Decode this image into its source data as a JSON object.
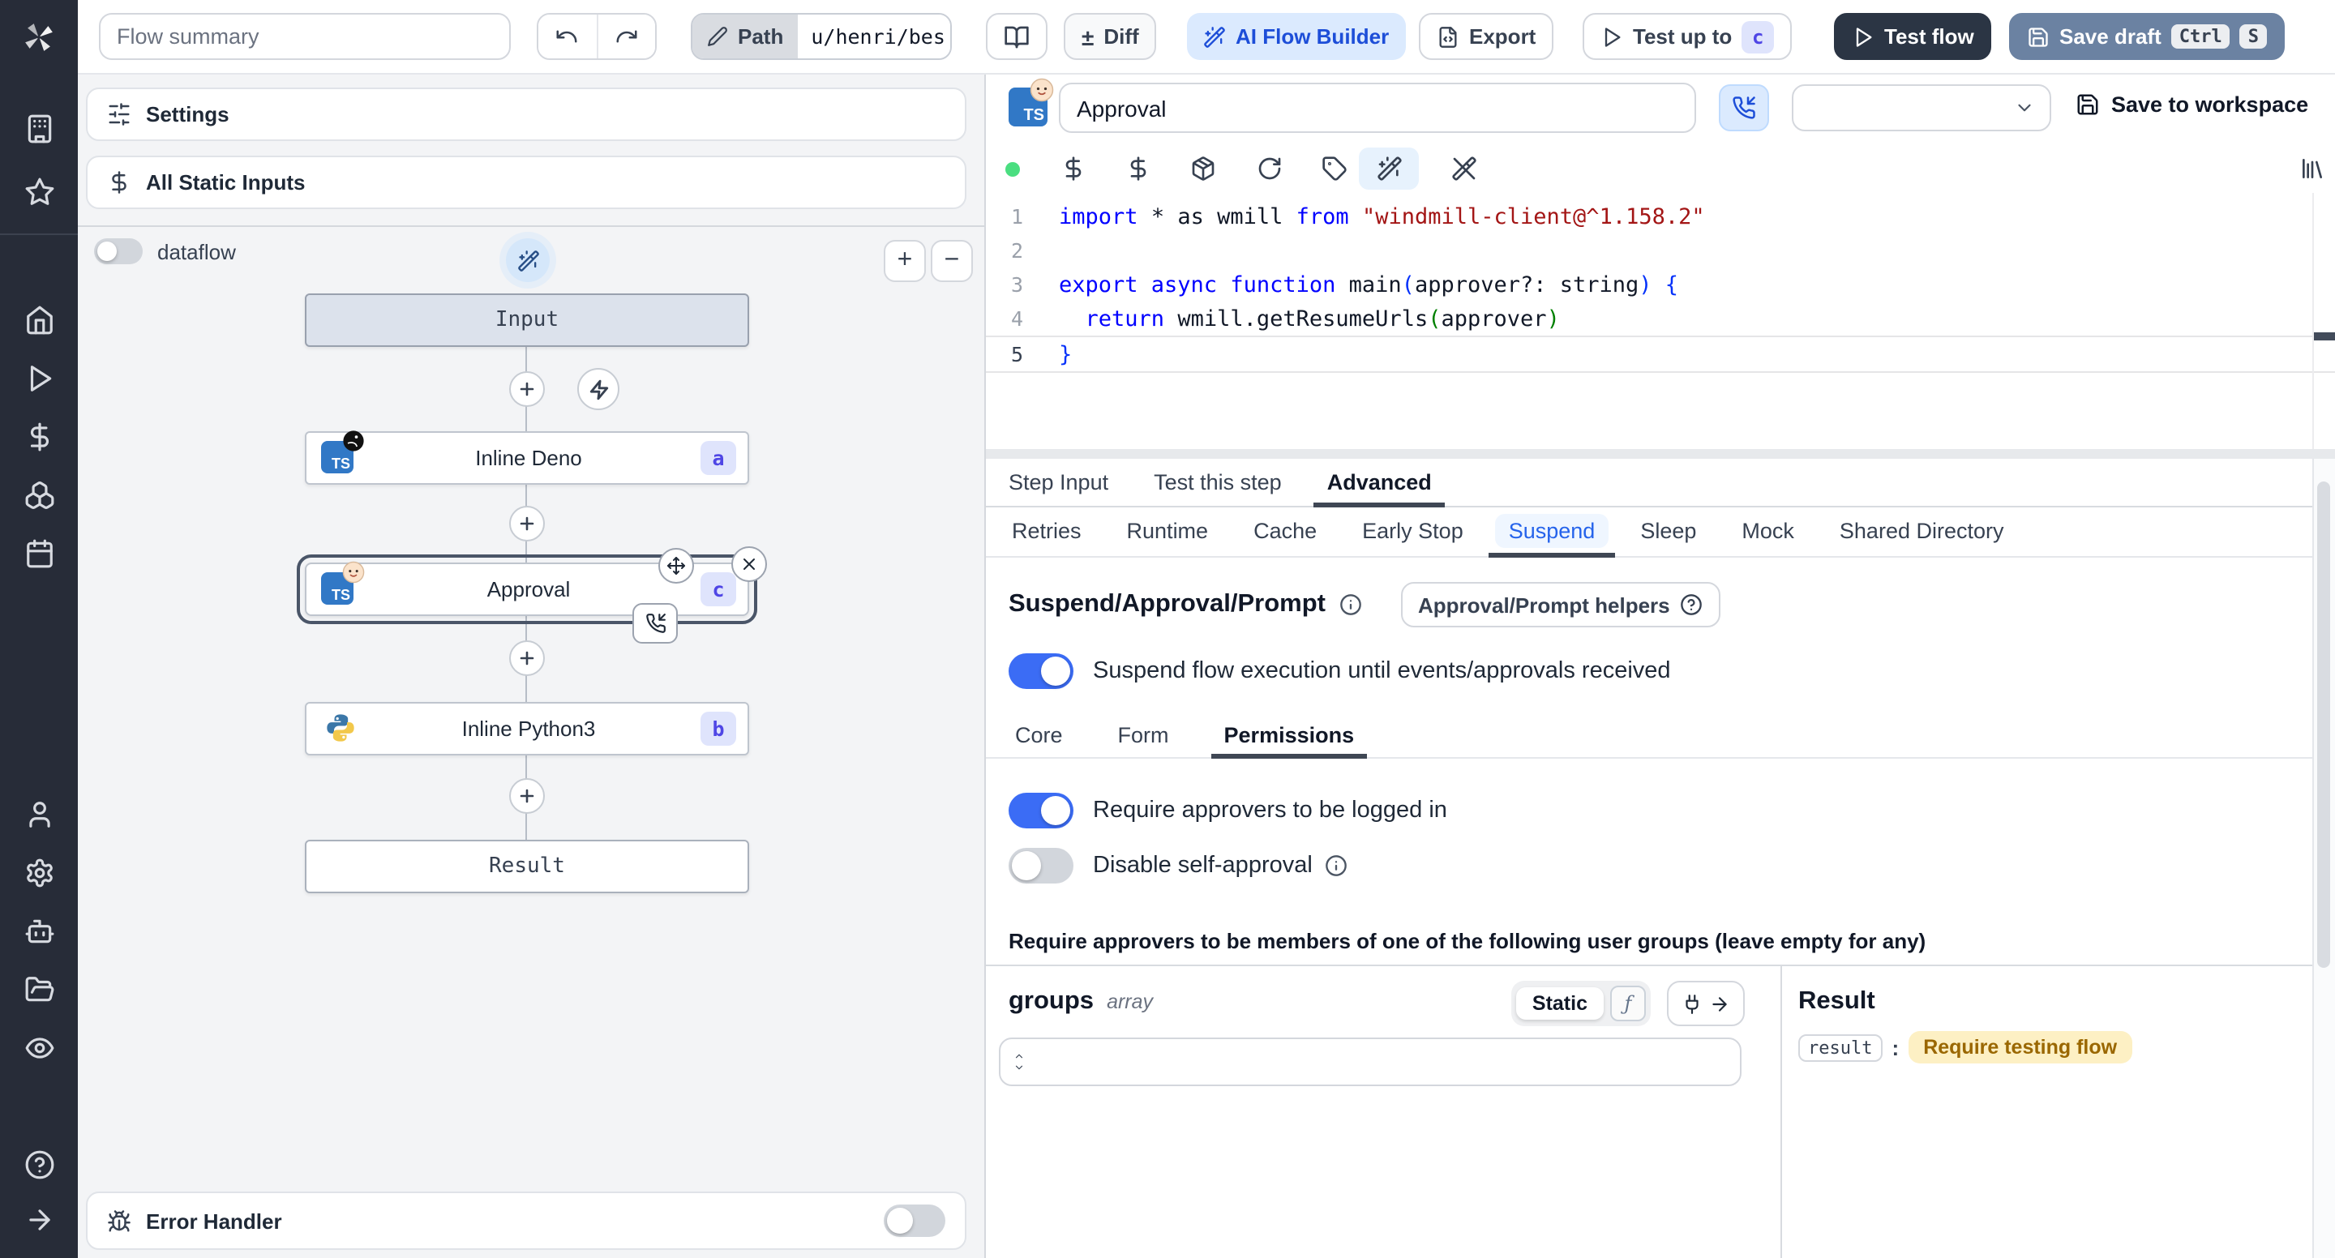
{
  "toolbar": {
    "flow_summary_placeholder": "Flow summary",
    "path_label": "Path",
    "path_value": "u/henri/bes",
    "diff_glyph": "±",
    "diff_label": "Diff",
    "ai_flow_builder_label": "AI Flow Builder",
    "export_label": "Export",
    "test_up_to_label": "Test up to",
    "test_up_to_badge": "c",
    "test_flow_label": "Test flow",
    "save_draft_label": "Save draft",
    "kbd_ctrl": "Ctrl",
    "kbd_s": "S"
  },
  "flow_panel": {
    "settings_label": "Settings",
    "static_inputs_label": "All Static Inputs",
    "dataflow_label": "dataflow",
    "zoom_in_label": "+",
    "zoom_out_label": "−",
    "input_node_label": "Input",
    "result_node_label": "Result",
    "ts_label": "TS",
    "nodes": [
      {
        "label": "Inline Deno",
        "badge": "a"
      },
      {
        "label": "Approval",
        "badge": "c"
      },
      {
        "label": "Inline Python3",
        "badge": "b"
      }
    ],
    "error_handler_label": "Error Handler"
  },
  "step_editor": {
    "title_value": "Approval",
    "save_to_workspace_label": "Save to workspace",
    "language_badge": "TS",
    "code_lines": [
      {
        "n": "1",
        "s": [
          "import",
          " * as wmill ",
          "from",
          " ",
          "\"windmill-client@^1.158.2\""
        ]
      },
      {
        "n": "2",
        "s": [
          ""
        ]
      },
      {
        "n": "3",
        "s": [
          "export async function",
          " main",
          "(",
          "approver?: string",
          ") {"
        ]
      },
      {
        "n": "4",
        "s": [
          "  ",
          "return",
          " wmill.getResumeUrls",
          "(",
          "approver",
          ")"
        ]
      },
      {
        "n": "5",
        "s": [
          "}"
        ]
      }
    ],
    "tabs": [
      {
        "label": "Step Input"
      },
      {
        "label": "Test this step"
      },
      {
        "label": "Advanced"
      }
    ],
    "advanced_tabs": [
      {
        "label": "Retries"
      },
      {
        "label": "Runtime"
      },
      {
        "label": "Cache"
      },
      {
        "label": "Early Stop"
      },
      {
        "label": "Suspend"
      },
      {
        "label": "Sleep"
      },
      {
        "label": "Mock"
      },
      {
        "label": "Shared Directory"
      }
    ]
  },
  "suspend": {
    "heading": "Suspend/Approval/Prompt",
    "helpers_button_label": "Approval/Prompt helpers",
    "suspend_toggle_label": "Suspend flow execution until events/approvals received",
    "subtabs": [
      {
        "label": "Core"
      },
      {
        "label": "Form"
      },
      {
        "label": "Permissions"
      }
    ],
    "require_login_label": "Require approvers to be logged in",
    "disable_self_approval_label": "Disable self-approval",
    "groups_note": "Require approvers to be members of one of the following user groups (leave empty for any)",
    "groups_name": "groups",
    "groups_type": "array",
    "static_label": "Static",
    "fx_glyph": "ƒ",
    "result_heading": "Result",
    "result_key": "result",
    "result_sep": ":",
    "result_value": "Require testing flow"
  },
  "colors": {
    "toggle_on": "#3b6cf5",
    "ai_button_bg": "#dbeafe",
    "ai_button_text": "#1d4ed8",
    "node_badge_bg": "#dfe4fc",
    "node_badge_text": "#4f46e5",
    "dark_button_bg": "#2b3544",
    "save_draft_bg": "#6b82a2",
    "sidebar_bg": "#272c38",
    "panel_bg": "#f3f4f6",
    "status_dot": "#4ade80",
    "code_keyword": "#0000ff",
    "code_string": "#a31515",
    "result_badge_bg": "#fdf0c4",
    "result_badge_text": "#9a6700",
    "subtab_active_text": "#2563eb"
  }
}
